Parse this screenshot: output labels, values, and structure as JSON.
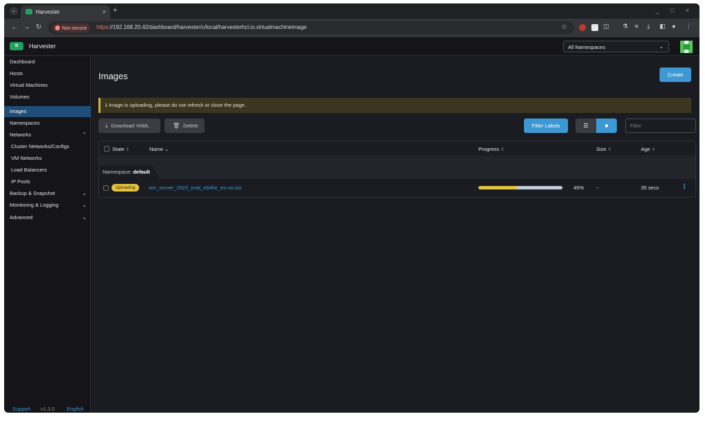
{
  "browser": {
    "tab_title": "Harvester",
    "tab_close": "×",
    "new_tab": "+",
    "window_controls": "_ □ ×",
    "security_label": "Not secure",
    "url_scheme": "https",
    "url_rest": "://192.168.20.42/dashboard/harvester/c/local/harvesterhci.io.virtualmachineimage"
  },
  "header": {
    "app_name": "Harvester",
    "namespace_select": "All Namespaces"
  },
  "sidebar": {
    "items": [
      {
        "label": "Dashboard"
      },
      {
        "label": "Hosts"
      },
      {
        "label": "Virtual Machines"
      },
      {
        "label": "Volumes"
      },
      {
        "label": "Images"
      },
      {
        "label": "Namespaces"
      },
      {
        "label": "Networks"
      },
      {
        "label": "Cluster Networks/Configs"
      },
      {
        "label": "VM Networks"
      },
      {
        "label": "Load Balancers"
      },
      {
        "label": "IP Pools"
      },
      {
        "label": "Backup & Snapshot"
      },
      {
        "label": "Monitoring & Logging"
      },
      {
        "label": "Advanced"
      }
    ],
    "footer": {
      "support": "Support",
      "version": "v1.3.0",
      "language": "English"
    }
  },
  "main": {
    "title": "Images",
    "create_label": "Create",
    "banner": "1 image is uploading, please do not refresh or close the page.",
    "download_yaml_label": "Download YAML",
    "delete_label": "Delete",
    "filter_labels_label": "Filter Labels",
    "filter_placeholder": "Filter",
    "columns": {
      "state": "State",
      "name": "Name",
      "progress": "Progress",
      "size": "Size",
      "age": "Age"
    },
    "group_prefix": "Namespace:",
    "group_name": "default",
    "rows": [
      {
        "state": "Uploading",
        "name": "win_server_2022_eval_x64fre_en-us.iso",
        "progress_label": "45%",
        "progress": 0.45,
        "size": "-",
        "age": "35 secs"
      }
    ]
  },
  "colors": {
    "accent": "#3d98d3",
    "uploading": "#e4c440",
    "active_nav": "#1f4e78",
    "brand": "#21a15d"
  }
}
